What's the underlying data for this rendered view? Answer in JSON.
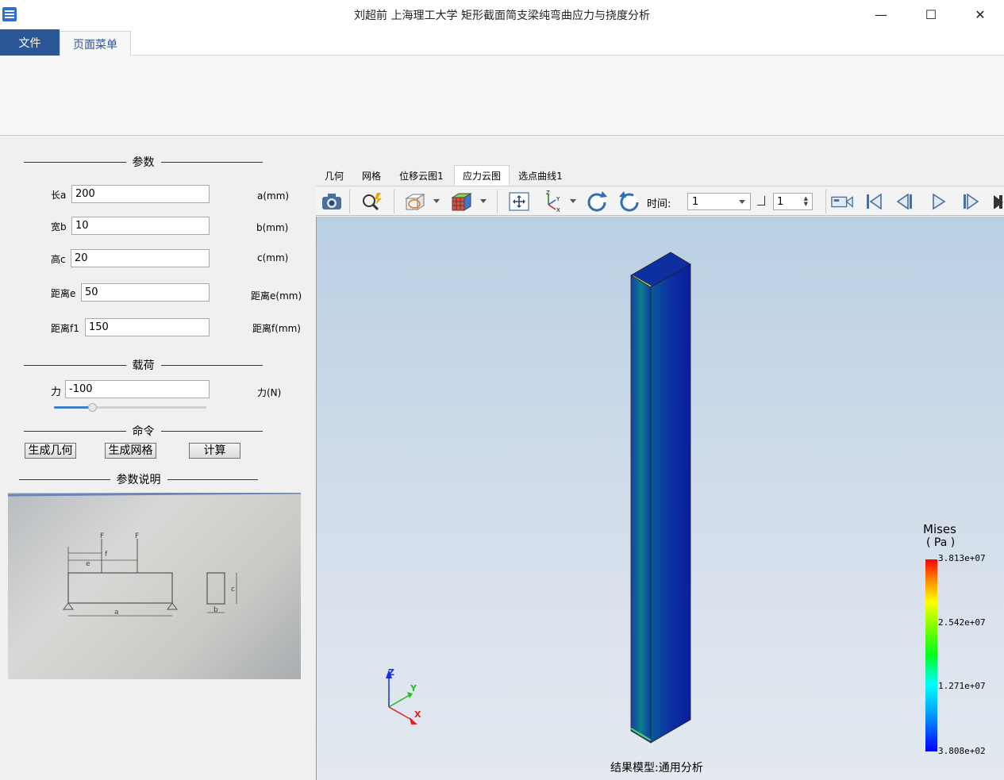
{
  "window": {
    "title": "刘超前    上海理工大学  矩形截面简支梁纯弯曲应力与挠度分析",
    "minimize_glyph": "—",
    "maximize_glyph": "☐",
    "close_glyph": "✕"
  },
  "ribbon": {
    "tabs": [
      "文件",
      "页面菜单"
    ]
  },
  "params": {
    "section_title": "参数",
    "fields": [
      {
        "label": "长a",
        "value": "200",
        "unit": "a(mm)"
      },
      {
        "label": "宽b",
        "value": "10",
        "unit": "b(mm)"
      },
      {
        "label": "高c",
        "value": "20",
        "unit": "c(mm)"
      },
      {
        "label": "距离e",
        "value": "50",
        "unit": "距离e(mm)"
      },
      {
        "label": "距离f1",
        "value": "150",
        "unit": "距离f(mm)"
      }
    ]
  },
  "load": {
    "section_title": "载荷",
    "label": "力",
    "value": "-100",
    "unit": "力(N)",
    "slider_fraction": 0.25
  },
  "commands": {
    "section_title": "命令",
    "buttons": [
      "生成几何",
      "生成网格",
      "计算"
    ]
  },
  "param_desc": {
    "section_title": "参数说明",
    "sketch_labels": {
      "F1": "F",
      "F2": "F",
      "f": "f",
      "e": "e",
      "a": "a",
      "b": "b",
      "c": "c"
    }
  },
  "viewer": {
    "tabs": [
      "几何",
      "网格",
      "位移云图1",
      "应力云图",
      "选点曲线1"
    ],
    "active_tab": 3,
    "time_label": "时间:",
    "time_value": "1",
    "step_value": "1",
    "result_model_label": "结果模型:通用分析",
    "axes": {
      "x": "X",
      "y": "Y",
      "z": "Z"
    }
  },
  "legend": {
    "title": "Mises",
    "unit": "( Pa )",
    "labels": [
      "3.813e+07",
      "2.542e+07",
      "1.271e+07",
      "3.808e+02"
    ]
  },
  "icons": [
    "app-icon",
    "camera-icon",
    "zoom-icon",
    "view-cube-icon",
    "color-cube-icon",
    "fit-icon",
    "axis-icon",
    "rotate-cw-icon",
    "rotate-ccw-icon",
    "record-icon",
    "first-frame-icon",
    "prev-frame-icon",
    "play-icon",
    "next-frame-icon",
    "last-frame-icon"
  ]
}
